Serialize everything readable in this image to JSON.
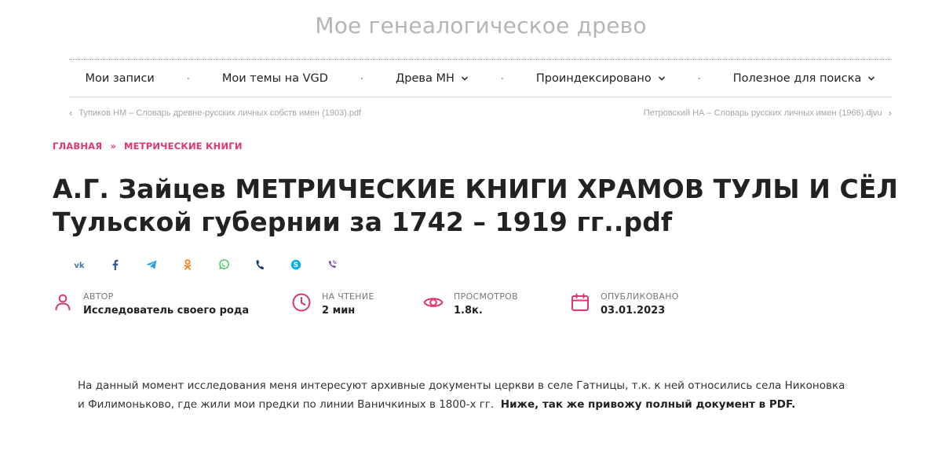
{
  "site": {
    "title": "Мое генеалогическое древо"
  },
  "nav": {
    "items": [
      {
        "label": "Мои записи",
        "has_dropdown": false
      },
      {
        "label": "Мои темы на VGD",
        "has_dropdown": false
      },
      {
        "label": "Древа МН",
        "has_dropdown": true
      },
      {
        "label": "Проиндексировано",
        "has_dropdown": true
      },
      {
        "label": "Полезное для поиска",
        "has_dropdown": true
      }
    ],
    "separator": "·"
  },
  "post_nav": {
    "prev": {
      "label": "Тупиков НМ – Словарь древне-русских личных собств имен (1903).pdf",
      "icon": "chevron-left-icon"
    },
    "next": {
      "label": "Петровский НА – Словарь русских личных имен (1966).djvu",
      "icon": "chevron-right-icon"
    }
  },
  "breadcrumb": {
    "home": "ГЛАВНАЯ",
    "separator": "»",
    "current": "МЕТРИЧЕСКИЕ КНИГИ"
  },
  "article": {
    "title": "А.Г. Зайцев МЕТРИЧЕСКИЕ КНИГИ ХРАМОВ ТУЛЫ И СЁЛ Тульской губернии за 1742 – 1919 гг..pdf",
    "meta": {
      "author": {
        "label": "АВТОР",
        "value": "Исследователь своего рода",
        "icon": "user-icon"
      },
      "reading": {
        "label": "НА ЧТЕНИЕ",
        "value": "2 мин",
        "icon": "clock-icon"
      },
      "views": {
        "label": "ПРОСМОТРОВ",
        "value": "1.8к.",
        "icon": "eye-icon"
      },
      "published": {
        "label": "ОПУБЛИКОВАНО",
        "value": "03.01.2023",
        "icon": "calendar-icon"
      }
    },
    "body": {
      "text": "На данный момент исследования меня интересуют архивные документы церкви в селе Гатницы, т.к. к ней относились села Никоновка и Филимоньково, где жили мои предки по линии Ваничкиных в 1800-х гг.",
      "bold": "Ниже, так же привожу полный документ в PDF."
    }
  },
  "share": [
    {
      "name": "vk",
      "icon": "vk-icon",
      "color": "#4a76a8"
    },
    {
      "name": "facebook",
      "icon": "facebook-icon",
      "color": "#3b5998"
    },
    {
      "name": "telegram",
      "icon": "telegram-icon",
      "color": "#2f9fd8"
    },
    {
      "name": "odnoklassniki",
      "icon": "odnoklassniki-icon",
      "color": "#f58220"
    },
    {
      "name": "whatsapp",
      "icon": "whatsapp-icon",
      "color": "#43c553"
    },
    {
      "name": "viber-phone",
      "icon": "phone-icon",
      "color": "#1d3f66"
    },
    {
      "name": "skype",
      "icon": "skype-icon",
      "color": "#00aff0"
    },
    {
      "name": "viber",
      "icon": "viber-icon",
      "color": "#7b519d"
    }
  ],
  "colors": {
    "accent": "#e0386c",
    "title_gray": "#b5b5b5"
  }
}
